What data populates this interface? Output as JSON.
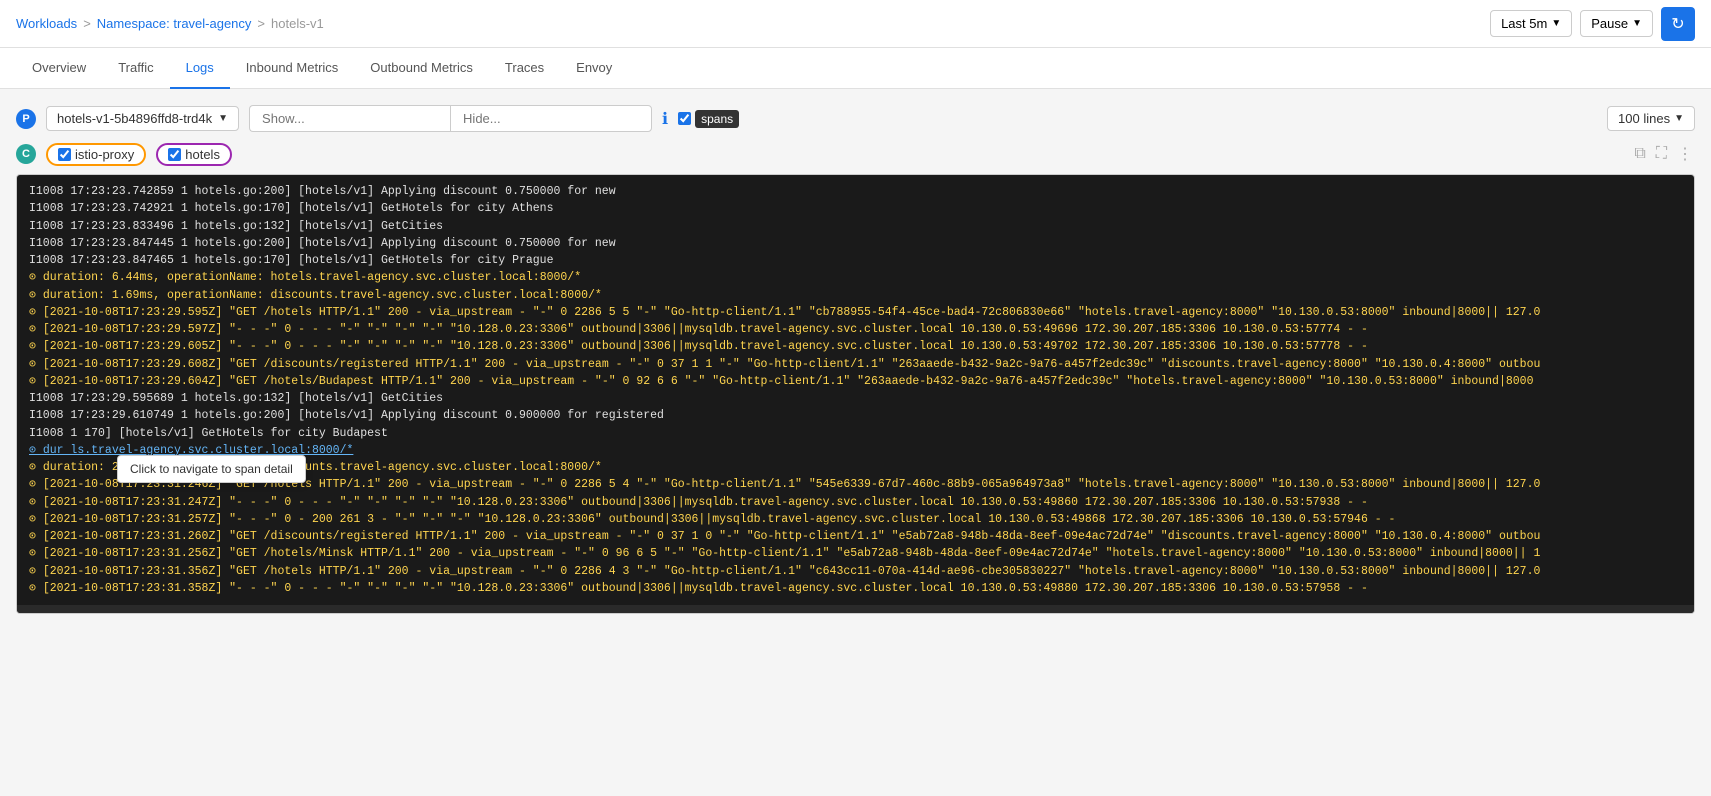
{
  "breadcrumb": {
    "workloads": "Workloads",
    "sep1": ">",
    "namespace": "Namespace: travel-agency",
    "sep2": ">",
    "service": "hotels-v1"
  },
  "topControls": {
    "timeRange": "Last 5m",
    "pause": "Pause",
    "refreshIcon": "↻"
  },
  "tabs": [
    {
      "id": "overview",
      "label": "Overview"
    },
    {
      "id": "traffic",
      "label": "Traffic"
    },
    {
      "id": "logs",
      "label": "Logs",
      "active": true
    },
    {
      "id": "inbound-metrics",
      "label": "Inbound Metrics"
    },
    {
      "id": "outbound-metrics",
      "label": "Outbound Metrics"
    },
    {
      "id": "traces",
      "label": "Traces"
    },
    {
      "id": "envoy",
      "label": "Envoy"
    }
  ],
  "podSelector": {
    "badge": "P",
    "value": "hotels-v1-5b4896ffd8-trd4k"
  },
  "showInput": {
    "placeholder": "Show..."
  },
  "hideInput": {
    "placeholder": "Hide..."
  },
  "spansLabel": "spans",
  "linesSelector": "100 lines",
  "containerBadge": "C",
  "containers": [
    {
      "id": "istio-proxy",
      "label": "istio-proxy",
      "checked": true,
      "color": "#ff9800"
    },
    {
      "id": "hotels",
      "label": "hotels",
      "checked": true,
      "color": "#9c27b0"
    }
  ],
  "tooltipText": "Click to navigate to span detail",
  "logLines": [
    {
      "type": "info",
      "text": "I1008 17:23:23.742859   1 hotels.go:200] [hotels/v1] Applying discount 0.750000 for new"
    },
    {
      "type": "info",
      "text": "I1008 17:23:23.742921   1 hotels.go:170] [hotels/v1] GetHotels for city Athens"
    },
    {
      "type": "info",
      "text": "I1008 17:23:23.833496   1 hotels.go:132] [hotels/v1] GetCities"
    },
    {
      "type": "info",
      "text": "I1008 17:23:23.847445   1 hotels.go:200] [hotels/v1] Applying discount 0.750000 for new"
    },
    {
      "type": "info",
      "text": "I1008 17:23:23.847465   1 hotels.go:170] [hotels/v1] GetHotels for city Prague"
    },
    {
      "type": "span",
      "text": "⊙ duration: 6.44ms, operationName: hotels.travel-agency.svc.cluster.local:8000/*"
    },
    {
      "type": "span",
      "text": "⊙ duration: 1.69ms, operationName: discounts.travel-agency.svc.cluster.local:8000/*"
    },
    {
      "type": "span",
      "text": "⊙ [2021-10-08T17:23:29.595Z] \"GET /hotels HTTP/1.1\" 200 - via_upstream - \"-\" 0 2286 5 5 \"-\" \"Go-http-client/1.1\" \"cb788955-54f4-45ce-bad4-72c806830e66\" \"hotels.travel-agency:8000\" \"10.130.0.53:8000\" inbound|8000|| 127.0"
    },
    {
      "type": "span",
      "text": "⊙ [2021-10-08T17:23:29.597Z] \"- - -\" 0 - - - \"-\" \"-\" \"-\" \"-\" \"10.128.0.23:3306\" outbound|3306||mysqldb.travel-agency.svc.cluster.local 10.130.0.53:49696 172.30.207.185:3306 10.130.0.53:57774 - -"
    },
    {
      "type": "span",
      "text": "⊙ [2021-10-08T17:23:29.605Z] \"- - -\" 0 - - - \"-\" \"-\" \"-\" \"-\" \"10.128.0.23:3306\" outbound|3306||mysqldb.travel-agency.svc.cluster.local 10.130.0.53:49702 172.30.207.185:3306 10.130.0.53:57778 - -"
    },
    {
      "type": "span",
      "text": "⊙ [2021-10-08T17:23:29.608Z] \"GET /discounts/registered HTTP/1.1\" 200 - via_upstream - \"-\" 0 37 1 1 \"-\" \"Go-http-client/1.1\" \"263aaede-b432-9a2c-9a76-a457f2edc39c\" \"discounts.travel-agency:8000\" \"10.130.0.4:8000\" outbou"
    },
    {
      "type": "span",
      "text": "⊙ [2021-10-08T17:23:29.604Z] \"GET /hotels/Budapest HTTP/1.1\" 200 - via_upstream - \"-\" 0 92 6 6 \"-\" \"Go-http-client/1.1\" \"263aaede-b432-9a2c-9a76-a457f2edc39c\" \"hotels.travel-agency:8000\" \"10.130.0.53:8000\" inbound|8000"
    },
    {
      "type": "info",
      "text": "I1008 17:23:29.595689   1 hotels.go:132] [hotels/v1] GetCities"
    },
    {
      "type": "info",
      "text": "I1008 17:23:29.610749   1 hotels.go:200] [hotels/v1] Applying discount 0.900000 for registered"
    },
    {
      "type": "info",
      "text": "I1008 1                         170] [hotels/v1] GetHotels for city Budapest"
    },
    {
      "type": "span-link",
      "text": "⊙ dur                                              ls.travel-agency.svc.cluster.local:8000/*"
    },
    {
      "type": "span",
      "text": "⊙ duration: 2.89ms, operationName: discounts.travel-agency.svc.cluster.local:8000/*"
    },
    {
      "type": "span",
      "text": "⊙ [2021-10-08T17:23:31.246Z] \"GET /hotels HTTP/1.1\" 200 - via_upstream - \"-\" 0 2286 5 4 \"-\" \"Go-http-client/1.1\" \"545e6339-67d7-460c-88b9-065a964973a8\" \"hotels.travel-agency:8000\" \"10.130.0.53:8000\" inbound|8000|| 127.0"
    },
    {
      "type": "span",
      "text": "⊙ [2021-10-08T17:23:31.247Z] \"- - -\" 0 - - - \"-\" \"-\" \"-\" \"-\" \"10.128.0.23:3306\" outbound|3306||mysqldb.travel-agency.svc.cluster.local 10.130.0.53:49860 172.30.207.185:3306 10.130.0.53:57938 - -"
    },
    {
      "type": "span",
      "text": "⊙ [2021-10-08T17:23:31.257Z] \"- - -\" 0 - 200 261 3 - \"-\" \"-\" \"-\" \"10.128.0.23:3306\" outbound|3306||mysqldb.travel-agency.svc.cluster.local 10.130.0.53:49868 172.30.207.185:3306 10.130.0.53:57946 - -"
    },
    {
      "type": "span",
      "text": "⊙ [2021-10-08T17:23:31.260Z] \"GET /discounts/registered HTTP/1.1\" 200 - via_upstream - \"-\" 0 37 1 0 \"-\" \"Go-http-client/1.1\" \"e5ab72a8-948b-48da-8eef-09e4ac72d74e\" \"discounts.travel-agency:8000\" \"10.130.0.4:8000\" outbou"
    },
    {
      "type": "span",
      "text": "⊙ [2021-10-08T17:23:31.256Z] \"GET /hotels/Minsk HTTP/1.1\" 200 - via_upstream - \"-\" 0 96 6 5 \"-\" \"Go-http-client/1.1\" \"e5ab72a8-948b-48da-8eef-09e4ac72d74e\" \"hotels.travel-agency:8000\" \"10.130.0.53:8000\" inbound|8000|| 1"
    },
    {
      "type": "span",
      "text": "⊙ [2021-10-08T17:23:31.356Z] \"GET /hotels HTTP/1.1\" 200 - via_upstream - \"-\" 0 2286 4 3 \"-\" \"Go-http-client/1.1\" \"c643cc11-070a-414d-ae96-cbe305830227\" \"hotels.travel-agency:8000\" \"10.130.0.53:8000\" inbound|8000|| 127.0"
    },
    {
      "type": "span",
      "text": "⊙ [2021-10-08T17:23:31.358Z] \"- - -\" 0 - - - \"-\" \"-\" \"-\" \"-\" \"10.128.0.23:3306\" outbound|3306||mysqldb.travel-agency.svc.cluster.local 10.130.0.53:49880 172.30.207.185:3306 10.130.0.53:57958 - -"
    }
  ]
}
